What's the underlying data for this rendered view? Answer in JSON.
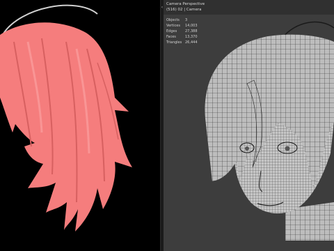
{
  "viewport_right": {
    "camera_label": "Camera Perspective",
    "scene_label": "(516) 02 | Camera",
    "stats": [
      {
        "label": "Objects",
        "value": "3"
      },
      {
        "label": "Vertices",
        "value": "14,003"
      },
      {
        "label": "Edges",
        "value": "27,388"
      },
      {
        "label": "Faces",
        "value": "13,370"
      },
      {
        "label": "Triangles",
        "value": "26,444"
      }
    ]
  },
  "colors": {
    "hair": "#f57d7d",
    "hair_shade": "#d76060",
    "mesh_fill": "#bdbdbd",
    "mesh_wire": "#2a2a2a",
    "viewport_bg": "#3d3d3d"
  },
  "icons": {
    "nav_toggle": "chevron-icon"
  }
}
